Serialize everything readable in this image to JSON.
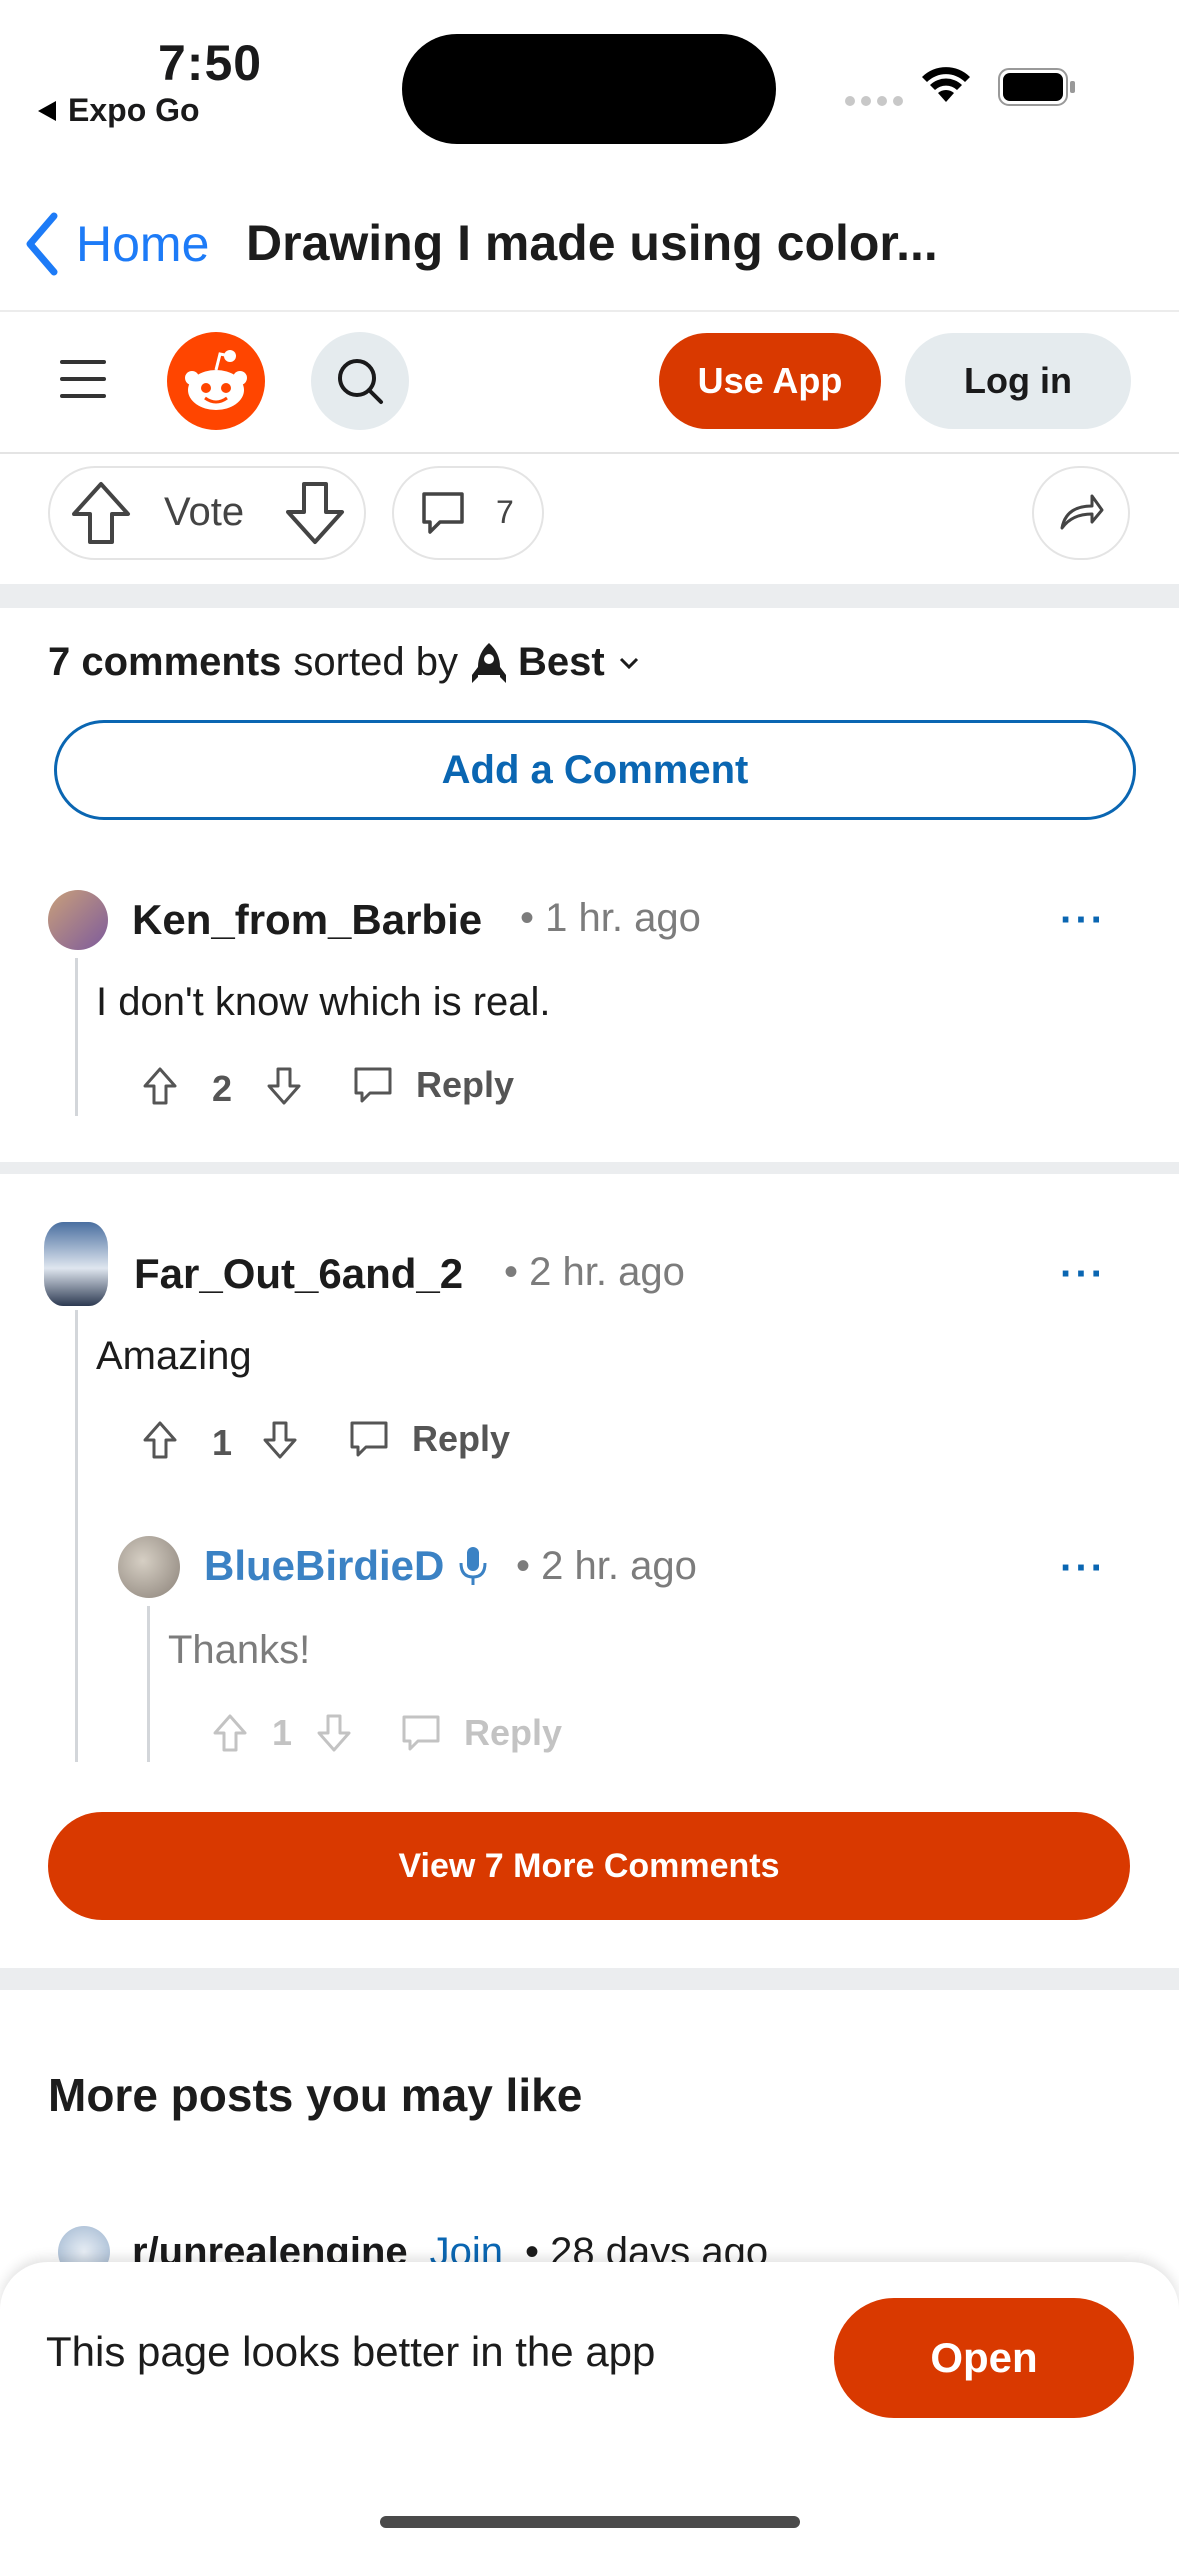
{
  "status_bar": {
    "time": "7:50",
    "back_app": "Expo Go"
  },
  "nav": {
    "back_label": "Home",
    "title": "Drawing I made using color..."
  },
  "header": {
    "use_app": "Use App",
    "login": "Log in"
  },
  "vote_row": {
    "vote_label": "Vote",
    "comment_count": "7"
  },
  "comments_section": {
    "count_label": "7 comments",
    "sorted_by": "sorted by",
    "sort_value": "Best",
    "add_comment": "Add a Comment"
  },
  "comments": [
    {
      "author": "Ken_from_Barbie",
      "time": "1 hr. ago",
      "body": "I don't know which is real.",
      "score": "2",
      "reply": "Reply"
    },
    {
      "author": "Far_Out_6and_2",
      "time": "2 hr. ago",
      "body": "Amazing",
      "score": "1",
      "reply": "Reply"
    },
    {
      "author": "BlueBirdieD",
      "time": "2 hr. ago",
      "body": "Thanks!",
      "score": "1",
      "reply": "Reply"
    }
  ],
  "view_more": "View 7 More Comments",
  "more_posts": {
    "heading": "More posts you may like",
    "first": {
      "subreddit": "r/unrealengine",
      "join": "Join",
      "time": "28 days ago"
    }
  },
  "bottom_sheet": {
    "text": "This page looks better in the app",
    "open": "Open"
  },
  "colors": {
    "accent": "#d93900",
    "link": "#0a66b2",
    "ios_blue": "#1d7bf7"
  }
}
